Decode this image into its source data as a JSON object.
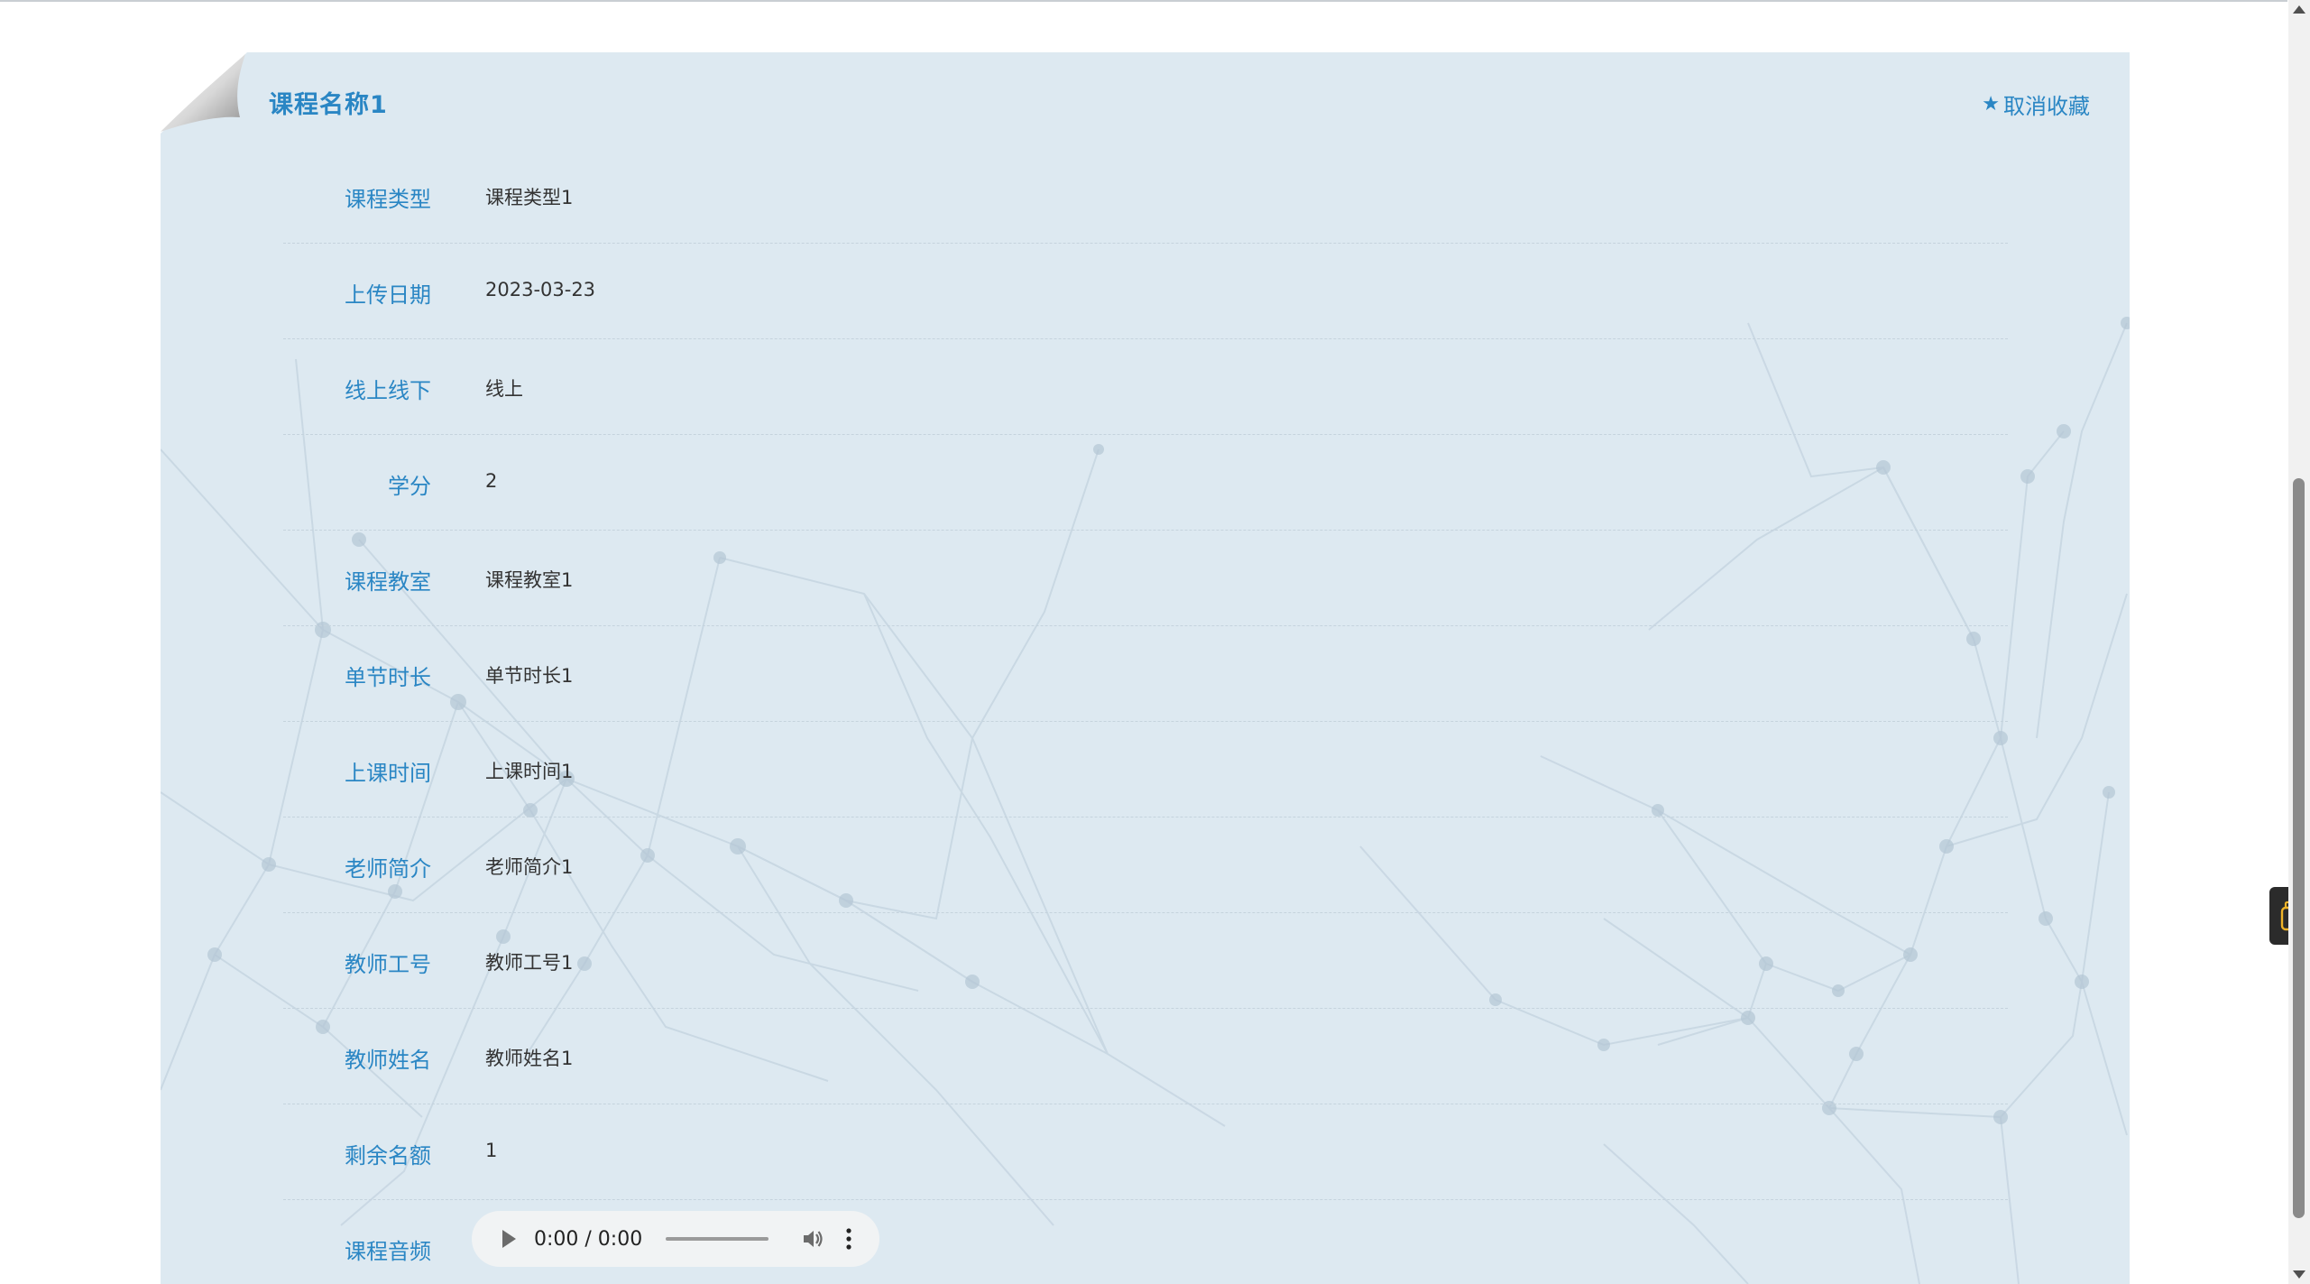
{
  "course": {
    "title": "课程名称1",
    "unfavorite_label": "取消收藏",
    "star_icon": "star-icon",
    "fields": [
      {
        "label": "课程类型",
        "value": "课程类型1"
      },
      {
        "label": "上传日期",
        "value": "2023-03-23"
      },
      {
        "label": "线上线下",
        "value": "线上"
      },
      {
        "label": "学分",
        "value": "2"
      },
      {
        "label": "课程教室",
        "value": "课程教室1"
      },
      {
        "label": "单节时长",
        "value": "单节时长1"
      },
      {
        "label": "上课时间",
        "value": "上课时间1"
      },
      {
        "label": "老师简介",
        "value": "老师简介1"
      },
      {
        "label": "教师工号",
        "value": "教师工号1"
      },
      {
        "label": "教师姓名",
        "value": "教师姓名1"
      },
      {
        "label": "剩余名额",
        "value": "1"
      }
    ],
    "audio_label": "课程音频",
    "audio_time": "0:00 / 0:00"
  },
  "colors": {
    "accent": "#2a86c4",
    "card_bg": "#dde9f1"
  }
}
